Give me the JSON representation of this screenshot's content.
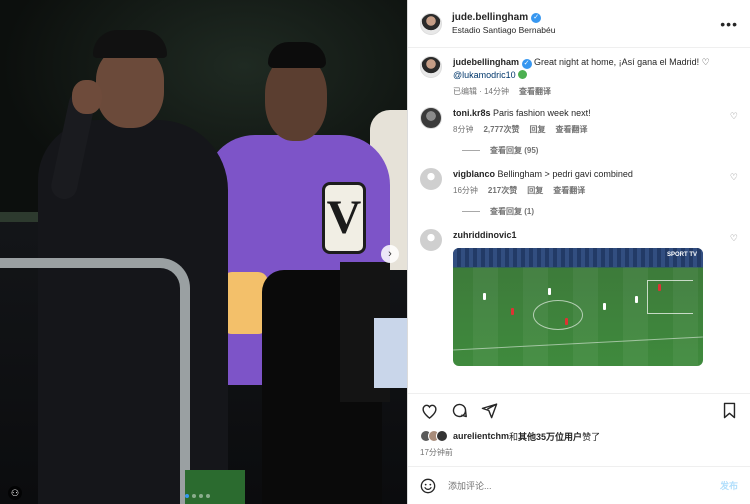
{
  "post": {
    "username": "jude.bellingham",
    "location": "Estadio Santiago Bernabéu",
    "more_label": "•••"
  },
  "media": {
    "next_label": "›",
    "tag_label": "⚇",
    "carousel_count": 4,
    "active_index": 0
  },
  "caption": {
    "username": "judebellingham",
    "text": "Great night at home, ¡Así gana el Madrid!",
    "mention": "@lukamodric10",
    "edited_label": "已编辑",
    "time": "14分钟",
    "translate": "查看翻译"
  },
  "comments": [
    {
      "username": "toni.kr8s",
      "text": "Paris fashion week next!",
      "time": "8分钟",
      "likes": "2,777次赞",
      "reply": "回复",
      "translate": "查看翻译",
      "replies_label": "查看回复 (95)"
    },
    {
      "username": "vigblanco",
      "text": "Bellingham > pedri gavi combined",
      "time": "16分钟",
      "likes": "217次赞",
      "reply": "回复",
      "translate": "查看翻译",
      "replies_label": "查看回复 (1)"
    },
    {
      "username": "zuhriddinovic1",
      "text": "",
      "media_logo": "SPORT TV"
    }
  ],
  "likes": {
    "first_liker": "aurelientchm",
    "connector": "和",
    "others": "其他35万位用户",
    "suffix": "赞了"
  },
  "post_time": "17分钟前",
  "composer": {
    "placeholder": "添加评论...",
    "post_label": "发布"
  },
  "icons": {
    "heart": "heart-icon",
    "comment": "comment-icon",
    "share": "share-icon",
    "save": "bookmark-icon",
    "emoji": "smile-icon"
  },
  "colors": {
    "accent": "#3797f0",
    "muted": "#737373",
    "post_disabled": "#b2dffc"
  }
}
